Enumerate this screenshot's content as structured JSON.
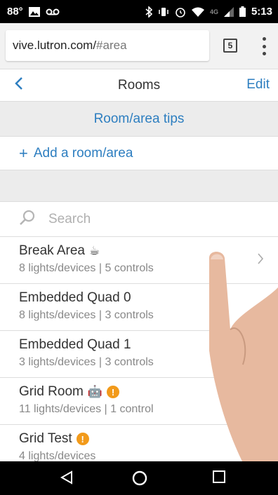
{
  "status": {
    "temperature": "88°",
    "time": "5:13",
    "network": "4G"
  },
  "browser": {
    "url_host": "vive.lutron.com/",
    "url_hash": "#area",
    "tab_count": "5"
  },
  "header": {
    "back_label": "<",
    "title": "Rooms",
    "edit_label": "Edit"
  },
  "tips_label": "Room/area tips",
  "add_label": "Add a room/area",
  "search": {
    "placeholder": "Search"
  },
  "rooms": [
    {
      "name": "Break Area",
      "detail": "8 lights/devices | 5 controls",
      "emoji": "☕",
      "warning": false
    },
    {
      "name": "Embedded Quad 0",
      "detail": "8 lights/devices | 3 controls",
      "emoji": "",
      "warning": false
    },
    {
      "name": "Embedded Quad 1",
      "detail": "3 lights/devices | 3 controls",
      "emoji": "",
      "warning": false
    },
    {
      "name": "Grid Room",
      "detail": "11 lights/devices | 1 control",
      "emoji": "🤖",
      "warning": true
    },
    {
      "name": "Grid Test",
      "detail": "4 lights/devices",
      "emoji": "",
      "warning": true
    }
  ],
  "colors": {
    "accent": "#2d7ec0",
    "warning": "#f29a1a",
    "divider_bg": "#ececec"
  }
}
